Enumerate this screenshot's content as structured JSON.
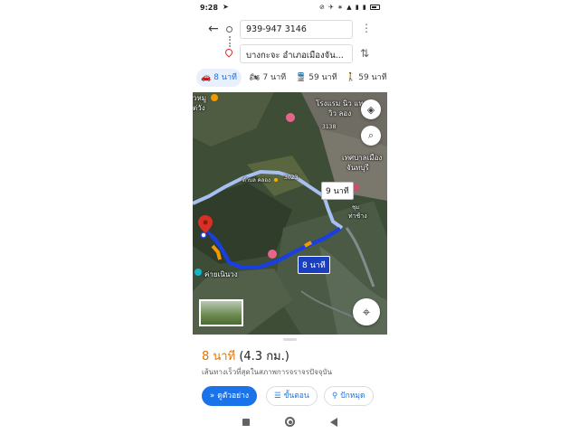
{
  "status_bar": {
    "time": "9:28",
    "indicators": "⊘ ✈ ∗ ▲ ▮ ▮"
  },
  "directions": {
    "origin": "939-947 3146",
    "destination": "บางกะจะ อำเภอเมืองจัน...",
    "back_icon": "arrow-back-icon",
    "more_icon": "more-vert-icon",
    "swap_icon": "swap-vert-icon"
  },
  "travel_modes": [
    {
      "icon": "car-icon",
      "glyph": "🚗",
      "label": "8 นาที",
      "active": true
    },
    {
      "icon": "motorcycle-icon",
      "glyph": "🏍",
      "label": "7 นาที",
      "active": false
    },
    {
      "icon": "transit-icon",
      "glyph": "🚆",
      "label": "59 นาที",
      "active": false
    },
    {
      "icon": "walk-icon",
      "glyph": "🚶",
      "label": "59 นาที",
      "active": false
    }
  ],
  "map": {
    "labels": {
      "top_left_1": "วหมู",
      "top_left_2": "ต่วัง",
      "hotel": "โรงแรม นิว แท",
      "hotel_2": "วิว ลอง",
      "road_no": "3138",
      "municipal_1": "เทศบาลเมือง",
      "municipal_2": "จันทบุรี",
      "village": "ตำบล คลอง",
      "road_no_2": "3023",
      "place_left": "ค่ายเนินวง",
      "place_right": "ท่าช้าง",
      "road_right": "ชุม"
    },
    "route_alt_time": "9 นาที",
    "route_main_time": "8 นาที",
    "colors": {
      "route_main": "#1a3fdc",
      "route_alt": "#a8bff2",
      "traffic": "#f29900",
      "destination_pin": "#d93025"
    }
  },
  "sheet": {
    "duration": "8 นาที",
    "distance": "(4.3 กม.)",
    "description": "เส้นทางเร็วที่สุดในสภาพการจราจรปัจจุบัน",
    "buttons": {
      "preview": "ดูตัวอย่าง",
      "steps": "ขั้นตอน",
      "pin": "ปักหมุด"
    }
  }
}
